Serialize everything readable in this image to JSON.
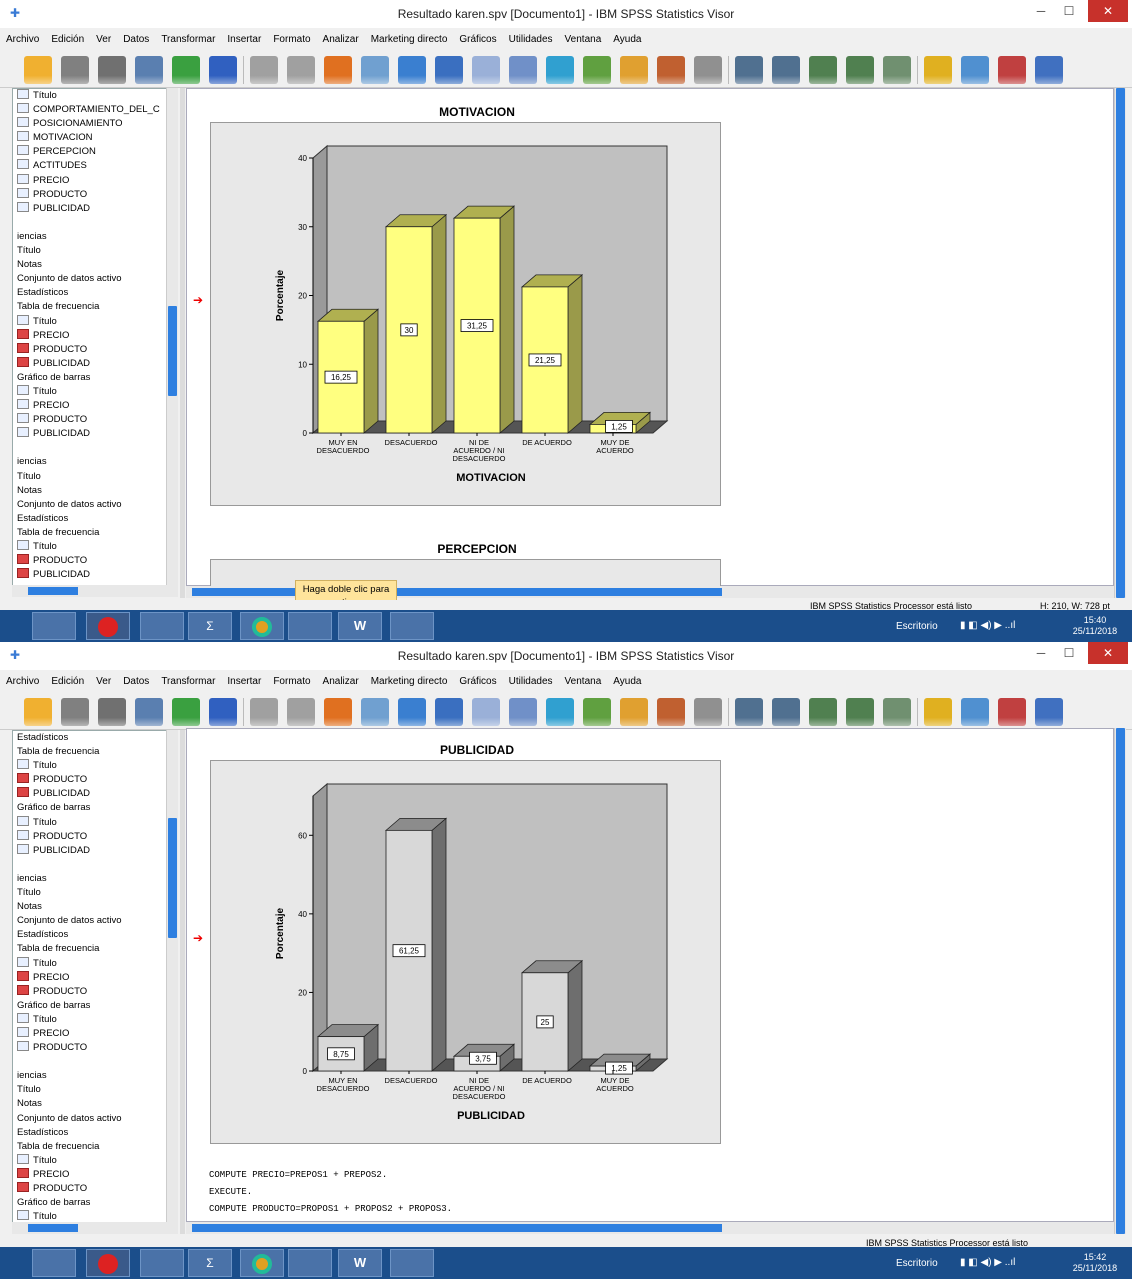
{
  "windows": [
    {
      "title": "Resultado karen.spv [Documento1] - IBM SPSS Statistics Visor",
      "menu": [
        "Archivo",
        "Edición",
        "Ver",
        "Datos",
        "Transformar",
        "Insertar",
        "Formato",
        "Analizar",
        "Marketing directo",
        "Gráficos",
        "Utilidades",
        "Ventana",
        "Ayuda"
      ],
      "outline": [
        {
          "label": "Título",
          "icon": "table"
        },
        {
          "label": "COMPORTAMIENTO_DEL_C",
          "icon": "chart"
        },
        {
          "label": "POSICIONAMIENTO",
          "icon": "chart"
        },
        {
          "label": "MOTIVACION",
          "icon": "chart"
        },
        {
          "label": "PERCEPCION",
          "icon": "chart"
        },
        {
          "label": "ACTITUDES",
          "icon": "chart"
        },
        {
          "label": "PRECIO",
          "icon": "chart"
        },
        {
          "label": "PRODUCTO",
          "icon": "chart"
        },
        {
          "label": "PUBLICIDAD",
          "icon": "chart"
        },
        {
          "label": "",
          "icon": "none"
        },
        {
          "label": "iencias",
          "icon": "none"
        },
        {
          "label": "Título",
          "icon": "none"
        },
        {
          "label": "Notas",
          "icon": "none"
        },
        {
          "label": "Conjunto de datos activo",
          "icon": "none"
        },
        {
          "label": "Estadísticos",
          "icon": "none"
        },
        {
          "label": "Tabla de frecuencia",
          "icon": "none"
        },
        {
          "label": "Título",
          "icon": "table"
        },
        {
          "label": "PRECIO",
          "icon": "red"
        },
        {
          "label": "PRODUCTO",
          "icon": "red"
        },
        {
          "label": "PUBLICIDAD",
          "icon": "red"
        },
        {
          "label": "Gráfico de barras",
          "icon": "none"
        },
        {
          "label": "Título",
          "icon": "table"
        },
        {
          "label": "PRECIO",
          "icon": "chart"
        },
        {
          "label": "PRODUCTO",
          "icon": "chart"
        },
        {
          "label": "PUBLICIDAD",
          "icon": "chart"
        },
        {
          "label": "",
          "icon": "none"
        },
        {
          "label": "iencias",
          "icon": "none"
        },
        {
          "label": "Título",
          "icon": "none"
        },
        {
          "label": "Notas",
          "icon": "none"
        },
        {
          "label": "Conjunto de datos activo",
          "icon": "none"
        },
        {
          "label": "Estadísticos",
          "icon": "none"
        },
        {
          "label": "Tabla de frecuencia",
          "icon": "none"
        },
        {
          "label": "Título",
          "icon": "table"
        },
        {
          "label": "PRODUCTO",
          "icon": "red"
        },
        {
          "label": "PUBLICIDAD",
          "icon": "red"
        }
      ],
      "next_chart_title": "PERCEPCION",
      "tooltip": "Haga doble clic para activar",
      "status_text": "IBM SPSS Statistics Processor está listo",
      "status_dims": "H: 210, W: 728 pt",
      "taskbar_desktop": "Escritorio",
      "clock_time": "15:40",
      "clock_date": "25/11/2018"
    },
    {
      "title": "Resultado karen.spv [Documento1] - IBM SPSS Statistics Visor",
      "outline": [
        {
          "label": "Estadísticos",
          "icon": "none"
        },
        {
          "label": "Tabla de frecuencia",
          "icon": "none"
        },
        {
          "label": "Título",
          "icon": "table"
        },
        {
          "label": "PRODUCTO",
          "icon": "red"
        },
        {
          "label": "PUBLICIDAD",
          "icon": "red"
        },
        {
          "label": "Gráfico de barras",
          "icon": "none"
        },
        {
          "label": "Título",
          "icon": "table"
        },
        {
          "label": "PRODUCTO",
          "icon": "chart"
        },
        {
          "label": "PUBLICIDAD",
          "icon": "chart"
        },
        {
          "label": "",
          "icon": "none"
        },
        {
          "label": "iencias",
          "icon": "none"
        },
        {
          "label": "Título",
          "icon": "none"
        },
        {
          "label": "Notas",
          "icon": "none"
        },
        {
          "label": "Conjunto de datos activo",
          "icon": "none"
        },
        {
          "label": "Estadísticos",
          "icon": "none"
        },
        {
          "label": "Tabla de frecuencia",
          "icon": "none"
        },
        {
          "label": "Título",
          "icon": "table"
        },
        {
          "label": "PRECIO",
          "icon": "red"
        },
        {
          "label": "PRODUCTO",
          "icon": "red"
        },
        {
          "label": "Gráfico de barras",
          "icon": "none"
        },
        {
          "label": "Título",
          "icon": "table"
        },
        {
          "label": "PRECIO",
          "icon": "chart"
        },
        {
          "label": "PRODUCTO",
          "icon": "chart"
        },
        {
          "label": "",
          "icon": "none"
        },
        {
          "label": "iencias",
          "icon": "none"
        },
        {
          "label": "Título",
          "icon": "none"
        },
        {
          "label": "Notas",
          "icon": "none"
        },
        {
          "label": "Conjunto de datos activo",
          "icon": "none"
        },
        {
          "label": "Estadísticos",
          "icon": "none"
        },
        {
          "label": "Tabla de frecuencia",
          "icon": "none"
        },
        {
          "label": "Título",
          "icon": "table"
        },
        {
          "label": "PRECIO",
          "icon": "red"
        },
        {
          "label": "PRODUCTO",
          "icon": "red"
        },
        {
          "label": "Gráfico de barras",
          "icon": "none"
        },
        {
          "label": "Título",
          "icon": "table"
        }
      ],
      "syntax": [
        "COMPUTE PRECIO=PREPOS1 + PREPOS2.",
        "EXECUTE.",
        "COMPUTE PRODUCTO=PROPOS1 + PROPOS2 + PROPOS3."
      ],
      "status_text": "IBM SPSS Statistics Processor está listo",
      "taskbar_desktop": "Escritorio",
      "clock_time": "15:42",
      "clock_date": "25/11/2018"
    }
  ],
  "chart_data": [
    {
      "type": "bar",
      "title": "MOTIVACION",
      "xlabel": "MOTIVACION",
      "ylabel": "Porcentaje",
      "categories": [
        "MUY EN DESACUERDO",
        "DESACUERDO",
        "NI DE ACUERDO / NI DESACUERDO",
        "DE ACUERDO",
        "MUY DE ACUERDO"
      ],
      "category_lines": [
        [
          "MUY EN",
          "DESACUERDO"
        ],
        [
          "DESACUERDO"
        ],
        [
          "NI DE",
          "ACUERDO / NI",
          "DESACUERDO"
        ],
        [
          "DE ACUERDO"
        ],
        [
          "MUY DE",
          "ACUERDO"
        ]
      ],
      "values": [
        16.25,
        30,
        31.25,
        21.25,
        1.25
      ],
      "value_labels": [
        "16,25",
        "30",
        "31,25",
        "21,25",
        "1,25"
      ],
      "ylim": [
        0,
        40
      ],
      "yticks": [
        0,
        10,
        20,
        30,
        40
      ],
      "bar_color": "#ffff80",
      "bar_side_color": "#9a9a4a",
      "bar_top_color": "#b0b050",
      "grid": false
    },
    {
      "type": "bar",
      "title": "PUBLICIDAD",
      "xlabel": "PUBLICIDAD",
      "ylabel": "Porcentaje",
      "categories": [
        "MUY EN DESACUERDO",
        "DESACUERDO",
        "NI DE ACUERDO / NI DESACUERDO",
        "DE ACUERDO",
        "MUY DE ACUERDO"
      ],
      "category_lines": [
        [
          "MUY EN",
          "DESACUERDO"
        ],
        [
          "DESACUERDO"
        ],
        [
          "NI DE",
          "ACUERDO / NI",
          "DESACUERDO"
        ],
        [
          "DE ACUERDO"
        ],
        [
          "MUY DE",
          "ACUERDO"
        ]
      ],
      "values": [
        8.75,
        61.25,
        3.75,
        25,
        1.25
      ],
      "value_labels": [
        "8,75",
        "61,25",
        "3,75",
        "25",
        "1,25"
      ],
      "ylim": [
        0,
        70
      ],
      "yticks": [
        0,
        20,
        40,
        60
      ],
      "bar_color": "#d8d8d8",
      "bar_side_color": "#6e6e6e",
      "bar_top_color": "#8c8c8c",
      "grid": false
    }
  ]
}
